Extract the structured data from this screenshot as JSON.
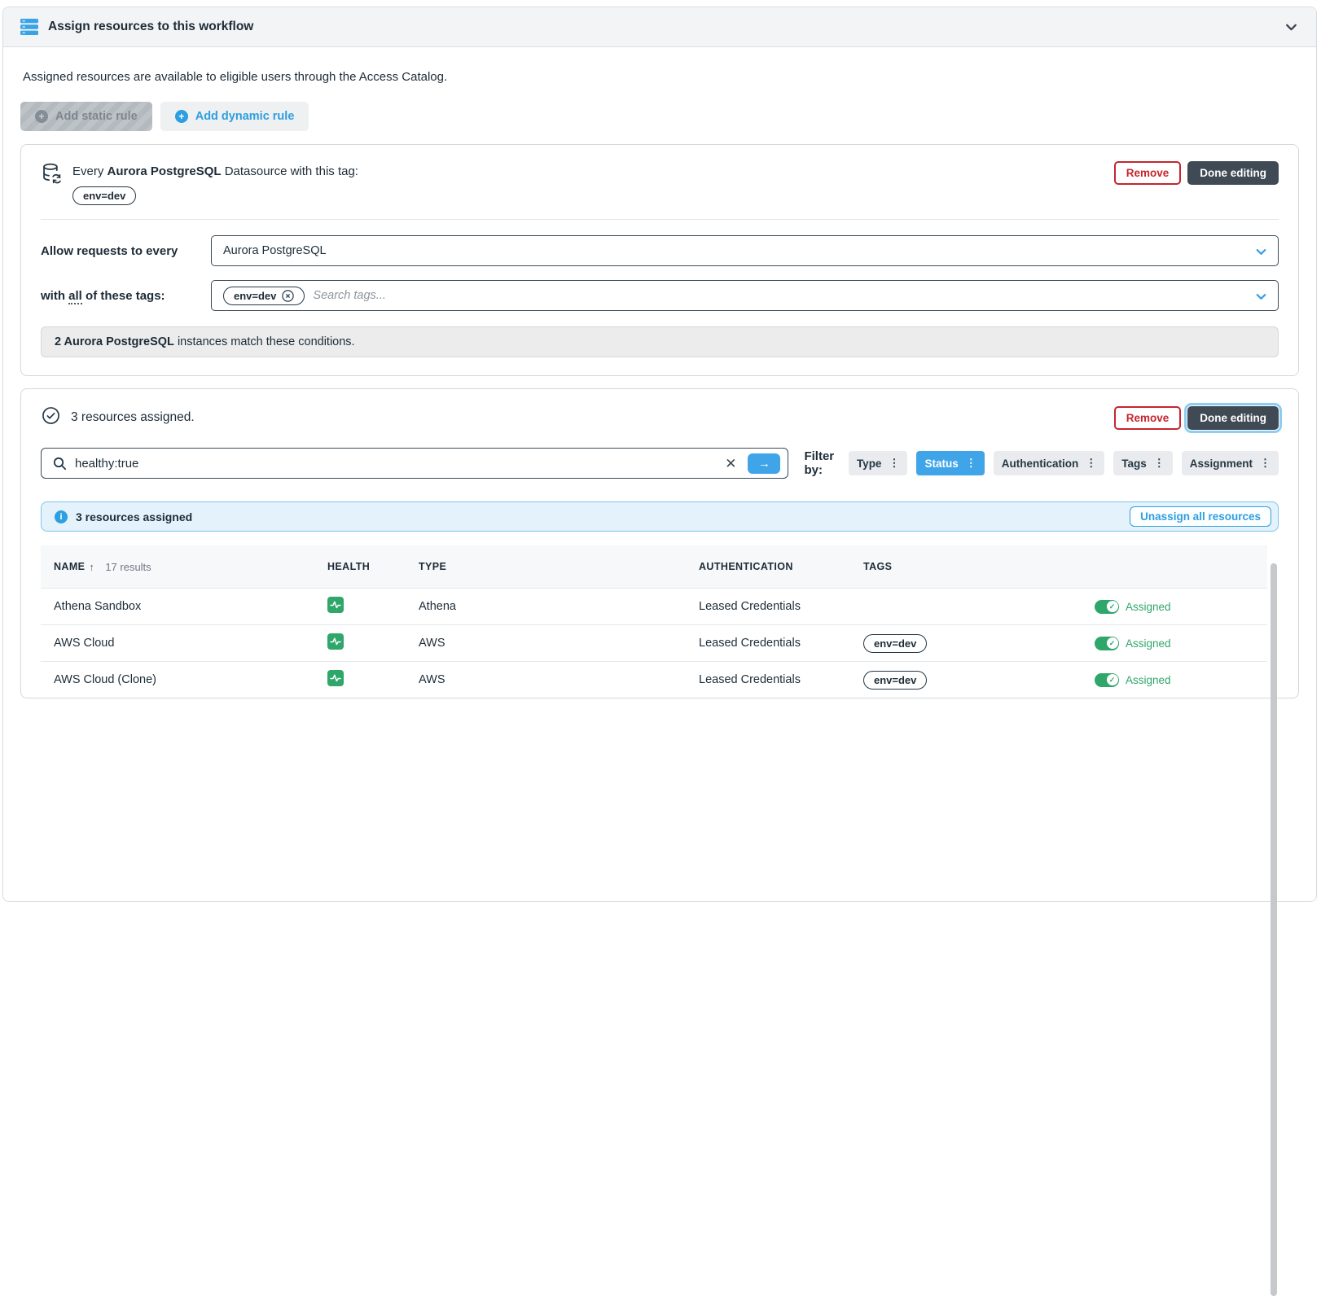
{
  "panel": {
    "title": "Assign resources to this workflow",
    "description": "Assigned resources are available to eligible users through the Access Catalog."
  },
  "actions": {
    "add_static_label": "Add static rule",
    "add_dynamic_label": "Add dynamic rule"
  },
  "dynamic_rule": {
    "summary_prefix": "Every ",
    "summary_resource": "Aurora PostgreSQL",
    "summary_suffix": " Datasource with this tag:",
    "summary_tag": "env=dev",
    "remove_label": "Remove",
    "done_label": "Done editing",
    "allow_label": "Allow requests to every",
    "resource_type_value": "Aurora PostgreSQL",
    "tags_label_prefix": "with ",
    "tags_label_all": "all",
    "tags_label_suffix": " of these tags:",
    "tag_chip": "env=dev",
    "tags_placeholder": "Search tags...",
    "match_bold": "2 Aurora PostgreSQL",
    "match_rest": " instances match these conditions."
  },
  "assigned_rule": {
    "summary": "3 resources assigned.",
    "remove_label": "Remove",
    "done_label": "Done editing",
    "search_value": "healthy:true",
    "filter_by_label": "Filter by:",
    "filters": [
      {
        "label": "Type",
        "active": false
      },
      {
        "label": "Status",
        "active": true
      },
      {
        "label": "Authentication",
        "active": false
      },
      {
        "label": "Tags",
        "active": false
      },
      {
        "label": "Assignment",
        "active": false
      }
    ],
    "banner_text": "3 resources assigned",
    "unassign_label": "Unassign all resources",
    "table": {
      "col_name": "NAME",
      "results_count": "17 results",
      "col_health": "HEALTH",
      "col_type": "TYPE",
      "col_auth": "AUTHENTICATION",
      "col_tags": "TAGS",
      "rows": [
        {
          "name": "Athena Sandbox",
          "type": "Athena",
          "auth": "Leased Credentials",
          "tag": "",
          "assigned": "Assigned"
        },
        {
          "name": "AWS Cloud",
          "type": "AWS",
          "auth": "Leased Credentials",
          "tag": "env=dev",
          "assigned": "Assigned"
        },
        {
          "name": "AWS Cloud (Clone)",
          "type": "AWS",
          "auth": "Leased Credentials",
          "tag": "env=dev",
          "assigned": "Assigned"
        }
      ]
    }
  },
  "icons": {
    "clear": "✕",
    "go_arrow": "→",
    "kebab": "⋮",
    "sort_asc": "↑",
    "plus": "+",
    "info": "i",
    "check": "✓"
  },
  "colors": {
    "accent_blue": "#3fa5e8",
    "dark_navy": "#1d2c38",
    "danger_red": "#c4262e",
    "success_green": "#2fa66a",
    "done_button_bg": "#3f4a54",
    "banner_bg": "#e4f3fb",
    "header_bg": "#f3f4f6"
  }
}
